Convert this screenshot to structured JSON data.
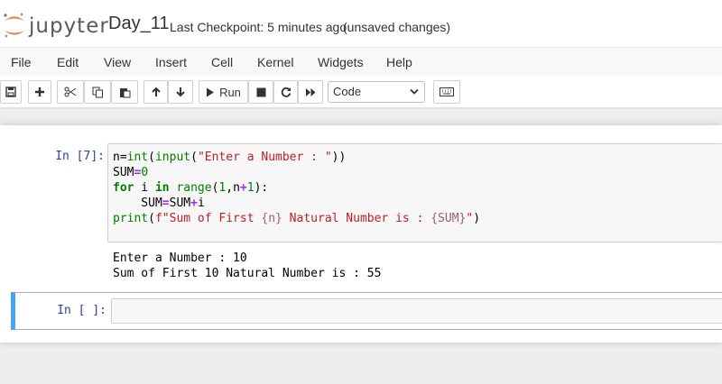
{
  "header": {
    "logo_text": "jupyter",
    "notebook_name": "Day_11",
    "checkpoint": "Last Checkpoint: 5 minutes ago",
    "save_status": "(unsaved changes)"
  },
  "menu": [
    "File",
    "Edit",
    "View",
    "Insert",
    "Cell",
    "Kernel",
    "Widgets",
    "Help"
  ],
  "toolbar": {
    "run_label": "Run",
    "cell_type": "Code",
    "icons": [
      "save-icon",
      "plus-icon",
      "cut-icon",
      "copy-icon",
      "paste-icon",
      "arrow-up-icon",
      "arrow-down-icon",
      "play-icon",
      "stop-icon",
      "restart-icon",
      "fast-forward-icon",
      "keyboard-icon"
    ]
  },
  "cells": [
    {
      "prompt": "In [7]:",
      "code": {
        "l1_pre": "n=",
        "l1_int": "int",
        "l1_open": "(",
        "l1_input": "input",
        "l1_open2": "(",
        "l1_str": "\"Enter a Number : \"",
        "l1_close": "))",
        "l2_a": "SUM",
        "l2_eq": "=",
        "l2_num": "0",
        "l3_for": "for",
        "l3_i": " i ",
        "l3_in": "in",
        "l3_sp": " ",
        "l3_range": "range",
        "l3_open": "(",
        "l3_num1": "1",
        "l3_mid": ",n",
        "l3_plus": "+",
        "l3_num2": "1",
        "l3_close": "):",
        "l4_pre": "    SUM",
        "l4_eq": "=",
        "l4_mid": "SUM",
        "l4_plus": "+",
        "l4_end": "i",
        "l5_print": "print",
        "l5_open": "(",
        "l5_s1": "f\"Sum of First ",
        "l5_i1": "{n}",
        "l5_s2": " Natural Number is : ",
        "l5_i2": "{SUM}",
        "l5_s3": "\"",
        "l5_close": ")"
      },
      "output": [
        "Enter a Number : 10",
        "Sum of First 10 Natural Number is : 55"
      ]
    },
    {
      "prompt": "In [ ]:",
      "code": ""
    }
  ],
  "colors": {
    "accent": "#f37626",
    "prompt": "#303f9f",
    "selected_cell_border": "#42a5f5"
  }
}
